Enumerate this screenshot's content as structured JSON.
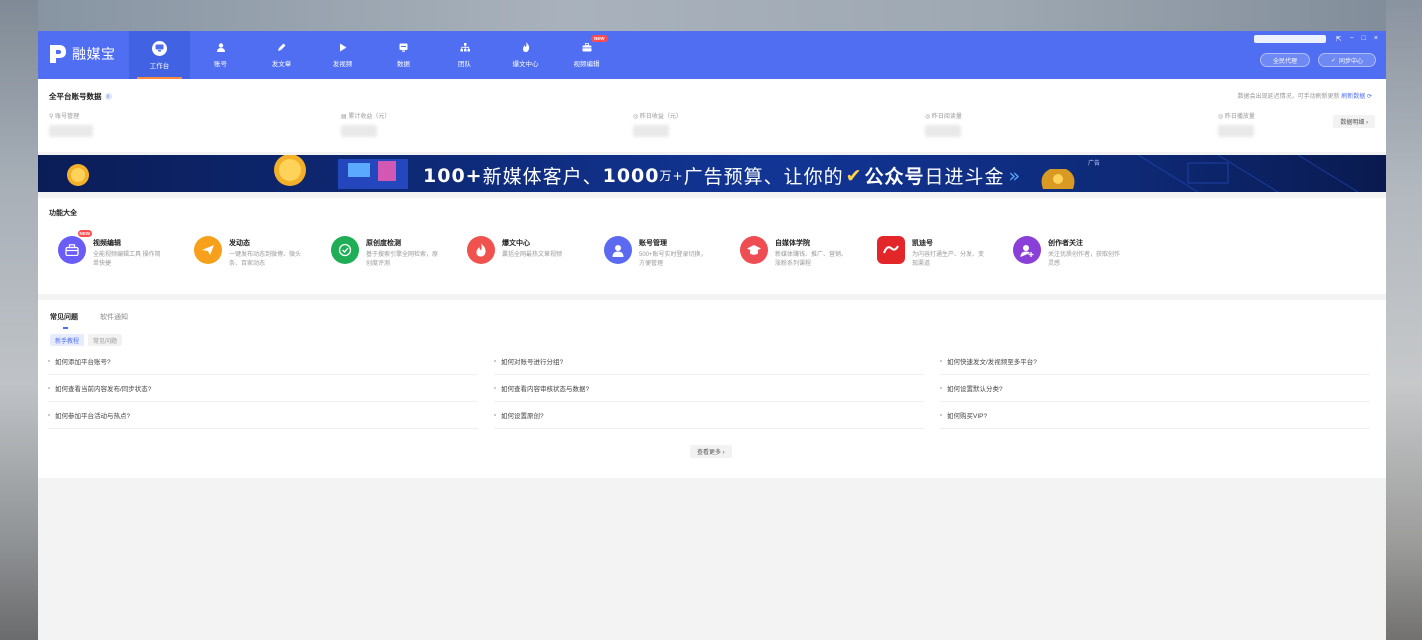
{
  "app": {
    "name": "融媒宝"
  },
  "nav": [
    {
      "label": "工作台",
      "icon": "monitor-icon",
      "active": true
    },
    {
      "label": "账号",
      "icon": "user-icon"
    },
    {
      "label": "发文章",
      "icon": "pen-icon"
    },
    {
      "label": "发视频",
      "icon": "play-icon"
    },
    {
      "label": "数据",
      "icon": "chart-icon"
    },
    {
      "label": "团队",
      "icon": "team-icon"
    },
    {
      "label": "爆文中心",
      "icon": "fire-icon"
    },
    {
      "label": "视频编辑",
      "icon": "toolbox-icon",
      "badge": "NEW"
    }
  ],
  "header_actions": {
    "agent": "全民代理",
    "sync": "同步中心"
  },
  "window_controls": {
    "pin": "⇱",
    "minimize": "−",
    "maximize": "□",
    "close": "×"
  },
  "stats": {
    "title": "全平台账号数据",
    "note": "数据会出现延迟情况，可手动刷新更新",
    "refresh": "刷新数据",
    "metrics": [
      {
        "label": "账号管理",
        "icon": "search-icon"
      },
      {
        "label": "累计收益（元）",
        "icon": "wallet-icon"
      },
      {
        "label": "昨日收益（元）",
        "icon": "coin-icon"
      },
      {
        "label": "昨日阅读量",
        "icon": "eye-icon"
      },
      {
        "label": "昨日播放量",
        "icon": "play-circle-icon"
      }
    ],
    "detail_btn": "数据明细 ›"
  },
  "banner": {
    "part1": "100+",
    "part2": "新媒体客户、",
    "part3": "1000",
    "part4": "万+",
    "part5": "广告预算、让你的",
    "part6": "公众号",
    "part7": "日进斗金",
    "ad": "广告"
  },
  "features": {
    "title": "功能大全",
    "items": [
      {
        "name": "视频编辑",
        "desc": "全能视频编辑工具 操作简单快捷",
        "color": "#6a5cf6",
        "icon": "toolbox-icon",
        "badge": "NEW"
      },
      {
        "name": "发动态",
        "desc": "一键发布动态到微博、微头条、百家动态",
        "color": "#f7a01c",
        "icon": "paper-plane-icon"
      },
      {
        "name": "原创度检测",
        "desc": "基于搜索引擎全网检索，原创度评测",
        "color": "#1fae55",
        "icon": "check-circle-icon"
      },
      {
        "name": "爆文中心",
        "desc": "囊括全网最热文章视频",
        "color": "#f0524d",
        "icon": "fire-icon"
      },
      {
        "name": "账号管理",
        "desc": "500+账号实时登录切换，方便管理",
        "color": "#5b6af0",
        "icon": "user-icon"
      },
      {
        "name": "自媒体学院",
        "desc": "新媒体赚钱、推广、营销、涨粉系列课程",
        "color": "#ee4d53",
        "icon": "graduation-cap-icon"
      },
      {
        "name": "凯迪号",
        "desc": "为内容打通生产、分发、变现渠道",
        "color": "#e3262a",
        "icon": "kaidi-logo-icon"
      },
      {
        "name": "创作者关注",
        "desc": "关注优质创作者，获取创作灵感",
        "color": "#8b3fd9",
        "icon": "user-add-icon"
      }
    ]
  },
  "faq": {
    "tabs": [
      "常见问题",
      "软件通知"
    ],
    "subtabs": [
      "新手教程",
      "常见问题"
    ],
    "questions": [
      "如何添加平台账号?",
      "如何对账号进行分组?",
      "如何快速发文/发视频至多平台?",
      "如何查看当前内容发布/同步状态?",
      "如何查看内容审核状态与数据?",
      "如何设置默认分类?",
      "如何参加平台活动与热点?",
      "如何设置原创?",
      "如何购买VIP?"
    ],
    "more": "查看更多 ›"
  }
}
